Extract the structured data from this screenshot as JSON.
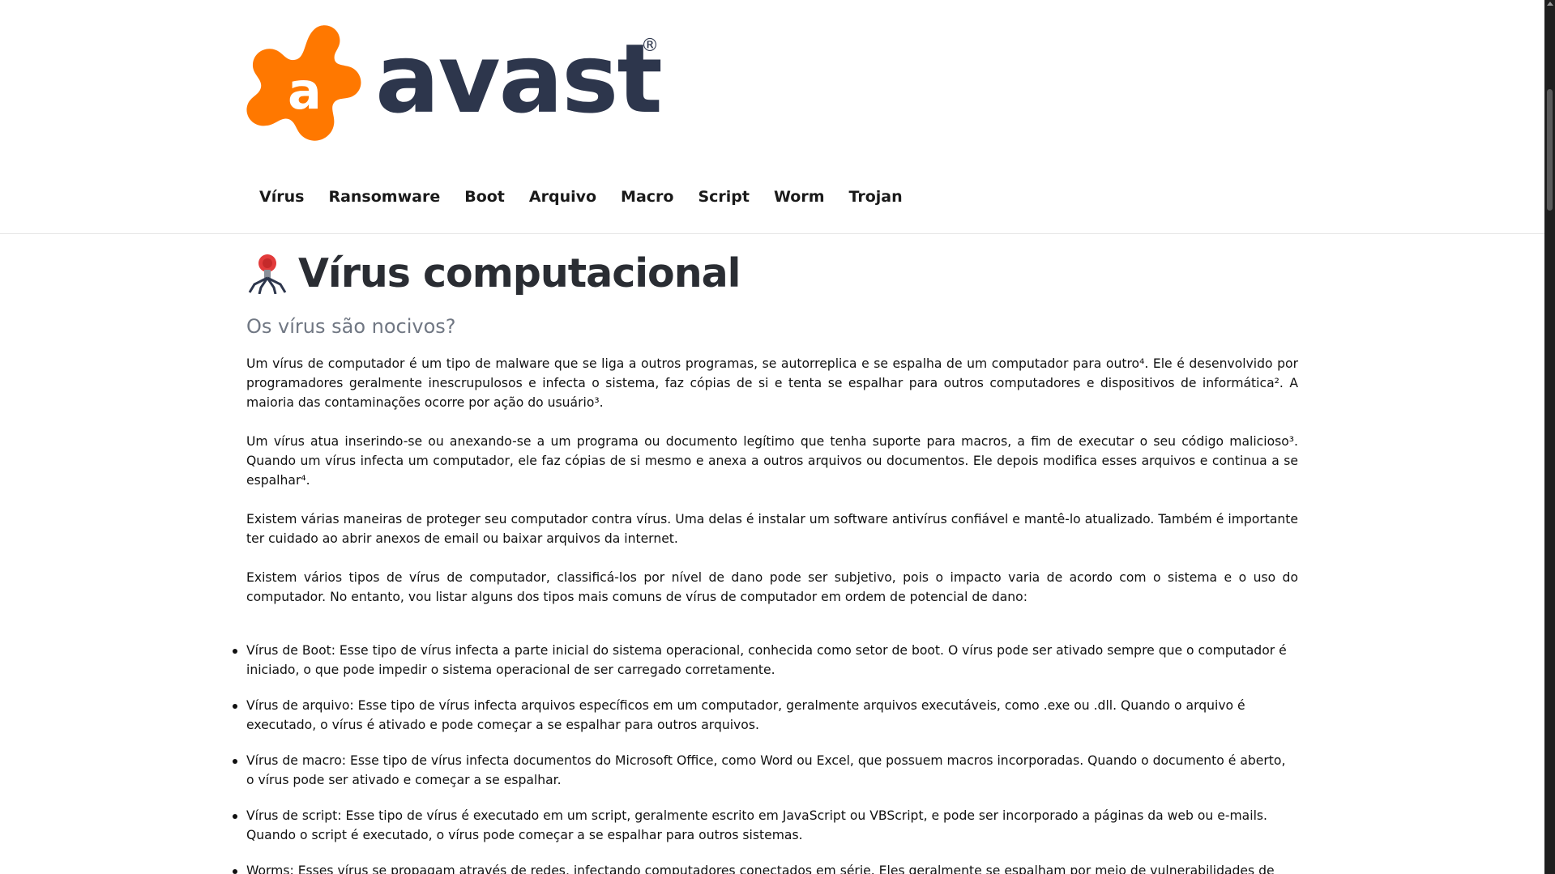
{
  "logo": {
    "word": "avast",
    "mark_letter": "a",
    "registered": "®",
    "brand_orange": "#ff7800",
    "brand_navy": "#2d364c"
  },
  "nav": {
    "items": [
      "Vírus",
      "Ransomware",
      "Boot",
      "Arquivo",
      "Macro",
      "Script",
      "Worm",
      "Trojan"
    ]
  },
  "main": {
    "title_icon": "virus-icon",
    "title": "Vírus computacional",
    "subtitle": "Os vírus são nocivos?",
    "paragraphs": [
      "Um vírus de computador é um tipo de malware que se liga a outros programas, se autorreplica e se espalha de um computador para outro⁴. Ele é desenvolvido por programadores geralmente inescrupulosos e infecta o sistema, faz cópias de si e tenta se espalhar para outros computadores e dispositivos de informática². A maioria das contaminações ocorre por ação do usuário³.",
      "Um vírus atua inserindo-se ou anexando-se a um programa ou documento legítimo que tenha suporte para macros, a fim de executar o seu código malicioso³. Quando um vírus infecta um computador, ele faz cópias de si mesmo e anexa a outros arquivos ou documentos. Ele depois modifica esses arquivos e continua a se espalhar⁴.",
      "Existem várias maneiras de proteger seu computador contra vírus. Uma delas é instalar um software antivírus confiável e mantê-lo atualizado. Também é importante ter cuidado ao abrir anexos de email ou baixar arquivos da internet.",
      "Existem vários tipos de vírus de computador, classificá-los por nível de dano pode ser subjetivo, pois o impacto varia de acordo com o sistema e o uso do computador. No entanto, vou listar alguns dos tipos mais comuns de vírus de computador em ordem de potencial de dano:"
    ],
    "types": [
      "Vírus de Boot: Esse tipo de vírus infecta a parte inicial do sistema operacional, conhecida como setor de boot. O vírus pode ser ativado sempre que o computador é iniciado, o que pode impedir o sistema operacional de ser carregado corretamente.",
      "Vírus de arquivo: Esse tipo de vírus infecta arquivos específicos em um computador, geralmente arquivos executáveis, como .exe ou .dll. Quando o arquivo é executado, o vírus é ativado e pode começar a se espalhar para outros arquivos.",
      "Vírus de macro: Esse tipo de vírus infecta documentos do Microsoft Office, como Word ou Excel, que possuem macros incorporadas. Quando o documento é aberto, o vírus pode ser ativado e começar a se espalhar.",
      "Vírus de script: Esse tipo de vírus é executado em um script, geralmente escrito em JavaScript ou VBScript, e pode ser incorporado a páginas da web ou e-mails. Quando o script é executado, o vírus pode começar a se espalhar para outros sistemas.",
      "Worms: Esses vírus se propagam através de redes, infectando computadores conectados em série. Eles geralmente se espalham por meio de vulnerabilidades de"
    ]
  }
}
